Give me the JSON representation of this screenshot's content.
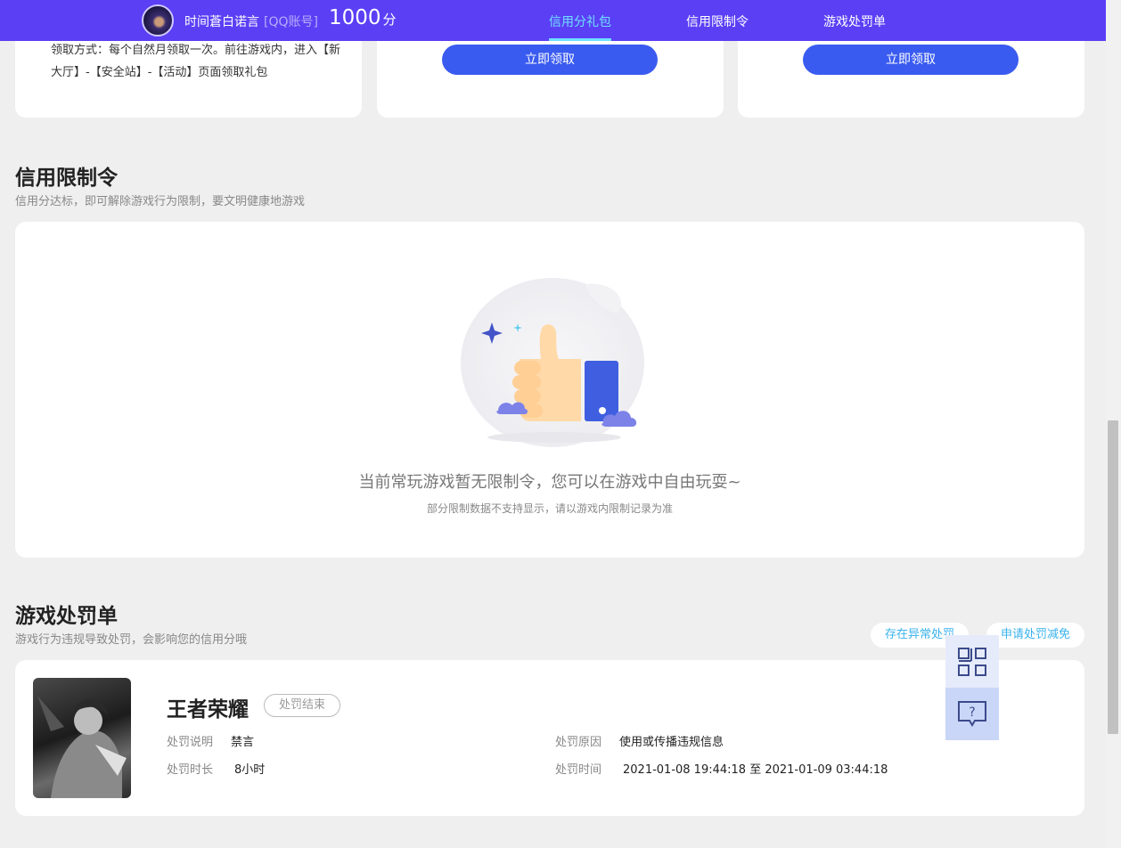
{
  "topbar": {
    "nickname": "时间蒼白诺言",
    "account_type": "[QQ账号]",
    "score": "1000",
    "score_unit": "分",
    "tabs": [
      {
        "label": "信用分礼包",
        "active": true
      },
      {
        "label": "信用限制令",
        "active": false
      },
      {
        "label": "游戏处罚单",
        "active": false
      }
    ]
  },
  "gift": {
    "claim_method": "领取方式：每个自然月领取一次。前往游戏内，进入【新大厅】-【安全站】-【活动】页面领取礼包",
    "claim_button_1": "立即领取",
    "claim_button_2": "立即领取"
  },
  "restriction": {
    "title": "信用限制令",
    "subtitle": "信用分达标，即可解除游戏行为限制，要文明健康地游戏",
    "empty_message": "当前常玩游戏暂无限制令，您可以在游戏中自由玩耍~",
    "empty_note": "部分限制数据不支持显示，请以游戏内限制记录为准"
  },
  "penalty": {
    "title": "游戏处罚单",
    "subtitle": "游戏行为违规导致处罚，会影响您的信用分哦",
    "abnormal_button": "存在异常处罚",
    "appeal_button": "申请处罚减免",
    "record": {
      "game": "王者荣耀",
      "status": "处罚结束",
      "desc_label": "处罚说明",
      "desc_value": "禁言",
      "duration_label": "处罚时长",
      "duration_value": "8小时",
      "reason_label": "处罚原因",
      "reason_value": "使用或传播违规信息",
      "time_label": "处罚时间",
      "time_value": "2021-01-08 19:44:18 至 2021-01-09 03:44:18"
    }
  },
  "side_tools": {
    "qr_icon": "qr-code-icon",
    "help_icon": "help-chat-icon"
  },
  "colors": {
    "nav_bg": "#5b3ff5",
    "nav_active": "#6fe0ff",
    "button_blue": "#3a5bf0",
    "link_blue": "#3ab2ee"
  }
}
